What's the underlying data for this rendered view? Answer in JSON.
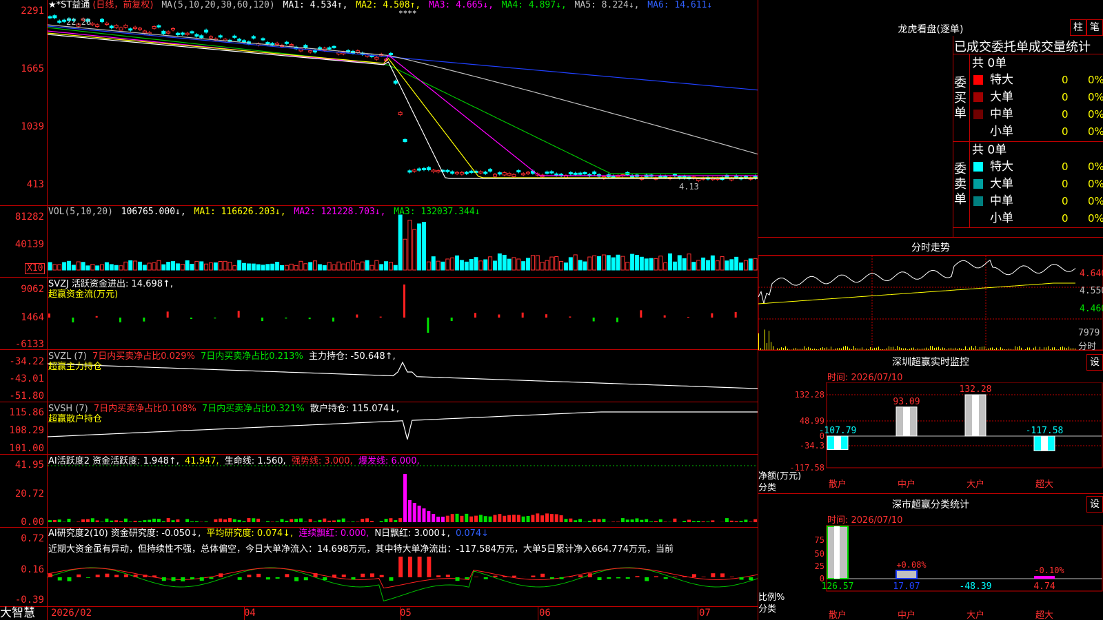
{
  "app": {
    "name": "大智慧",
    "stock": "★*ST益通",
    "period": "(日线，前复权)"
  },
  "main_header": {
    "ma_params": "MA(5,10,20,30,60,120)",
    "ma1": "MA1: 4.534↑,",
    "ma2": "MA2: 4.508↑,",
    "ma3": "MA3: 4.665↓,",
    "ma4": "MA4: 4.897↓,",
    "ma5": "MA5: 8.224↓,",
    "ma6": "MA6: 14.611↓",
    "marks": "****",
    "high_label": "22.28",
    "low_label": "4.13"
  },
  "main_axis": [
    "2291",
    "1665",
    "1039",
    "413"
  ],
  "vol": {
    "header": "VOL(5,10,20)",
    "value": "106765.000↓,",
    "ma1": "MA1: 116626.203↓,",
    "ma2": "MA2: 121228.703↓,",
    "ma3": "MA3: 132037.344↓",
    "axis": [
      "81282",
      "40139"
    ],
    "unit": "X10"
  },
  "svzj": {
    "header1": "SVZJ  活跃资金进出: 14.698↑,",
    "header2": "超赢资金流(万元)",
    "axis": [
      "9062",
      "1464",
      "-6133"
    ]
  },
  "svzl": {
    "h1": "SVZL (7)",
    "h2": "7日内买卖净占比0.029%",
    "h3": "7日内买卖净占比0.213%",
    "h4": "主力持仓: -50.648↑,",
    "h5": "超赢主力持仓",
    "axis": [
      "-34.22",
      "-43.01",
      "-51.80"
    ]
  },
  "svsh": {
    "h1": "SVSH (7)",
    "h2": "7日内买卖净占比0.108%",
    "h3": "7日内买卖净占比0.321%",
    "h4": "散户持仓: 115.074↓,",
    "h5": "超赢散户持仓",
    "axis": [
      "115.86",
      "108.29",
      "101.00"
    ]
  },
  "ai_act": {
    "h1": "AI活跃度2 资金活跃度: 1.948↑,",
    "h2": "41.947,",
    "h3": "生命线: 1.560,",
    "h4": "强势线: 3.000,",
    "h5": "爆发线: 6.000,",
    "axis": [
      "41.95",
      "20.72",
      "0.00"
    ]
  },
  "ai_res": {
    "h1": "AI研究度2(10) 资金研究度: -0.050↓,",
    "h2": "平均研究度: 0.074↓,",
    "h3": "连续飘红: 0.000,",
    "h4": "N日飘红: 3.000↓,",
    "h5": "0.074↓",
    "comment": "近期大资金虽有异动，但持续性不强，总体偏空，今日大单净流入：14.698万元，其中特大单净流出：-117.584万元，大单5日累计净入664.774万元，当前",
    "axis": [
      "0.72",
      "0.16",
      "-0.39"
    ]
  },
  "dates": [
    "2026/02",
    "04",
    "05",
    "06",
    "07"
  ],
  "right": {
    "title": "龙虎看盘(逐单)",
    "btn1": "柱",
    "btn2": "笔",
    "tabs": "已成交委托单成交量统计",
    "buy_label": "委买单",
    "sell_label": "委卖单",
    "buy_total": "共 0单",
    "sell_total": "共 0单",
    "buy_rows": [
      {
        "name": "特大",
        "count": "0",
        "pct": "0%",
        "color": "#ff0000"
      },
      {
        "name": "大单",
        "count": "0",
        "pct": "0%",
        "color": "#a00000"
      },
      {
        "name": "中单",
        "count": "0",
        "pct": "0%",
        "color": "#700000"
      },
      {
        "name": "小单",
        "count": "0",
        "pct": "0%",
        "color": "#000000"
      }
    ],
    "sell_rows": [
      {
        "name": "特大",
        "count": "0",
        "pct": "0%",
        "color": "#00ffff"
      },
      {
        "name": "大单",
        "count": "0",
        "pct": "0%",
        "color": "#00a0a0"
      },
      {
        "name": "中单",
        "count": "0",
        "pct": "0%",
        "color": "#008080"
      },
      {
        "name": "小单",
        "count": "0",
        "pct": "0%",
        "color": "#000000"
      }
    ],
    "intraday_title": "分时走势",
    "intraday_axis": [
      "4.640",
      "4.550",
      "4.460"
    ],
    "intraday_vol": "7979",
    "intraday_vol_label": "分时",
    "monitor_title": "深圳超赢实时监控",
    "monitor_btn": "设",
    "monitor_time": "时间: 2026/07/10",
    "monitor_axis": [
      "132.28",
      "48.99",
      "0",
      "-34.3",
      "-117.58"
    ],
    "monitor_values": [
      {
        "cat": "散户",
        "value": -107.79,
        "label": "-107.79"
      },
      {
        "cat": "中户",
        "value": 93.09,
        "label": "93.09"
      },
      {
        "cat": "大户",
        "value": 132.28,
        "label": "132.28"
      },
      {
        "cat": "超大",
        "value": -117.58,
        "label": "-117.58"
      }
    ],
    "monitor_ylabel1": "净额(万元)",
    "monitor_ylabel2": "分类",
    "stat_title": "深市超赢分类统计",
    "stat_btn": "设",
    "stat_time": "时间: 2026/07/10",
    "stat_axis": [
      "75",
      "50",
      "25",
      "0"
    ],
    "stat_pct_labels": [
      "+0.08%",
      "-0.10%"
    ],
    "stat_values": [
      {
        "cat": "散户",
        "value": "126.57"
      },
      {
        "cat": "中户",
        "value": "17.07"
      },
      {
        "cat": "大户",
        "value": "-48.39"
      },
      {
        "cat": "超大",
        "value": "4.74"
      }
    ],
    "stat_ylabel1": "比例%",
    "stat_ylabel2": "分类"
  }
}
